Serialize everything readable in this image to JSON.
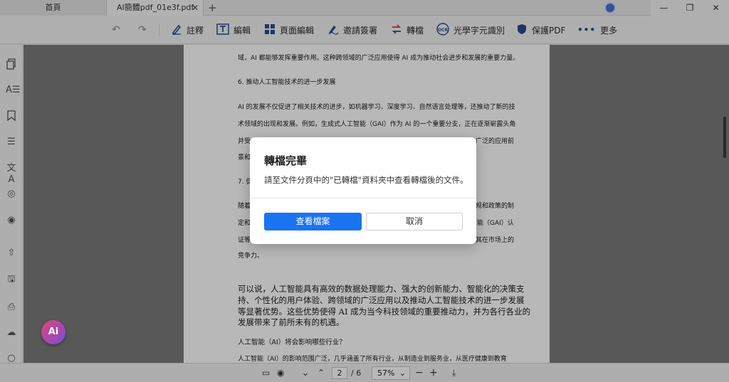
{
  "tabs": {
    "home_label": "首頁",
    "doc_label": "AI簡體pdf_01e3f.pdf",
    "close": "✕",
    "add": "+"
  },
  "window": {
    "minimize": "—",
    "restore": "❐",
    "close": "✕"
  },
  "toolbar": {
    "undo": "↶",
    "redo": "↷",
    "items": [
      {
        "label": "註釋",
        "icon": "pen-icon"
      },
      {
        "label": "編輯",
        "icon": "text-edit-icon"
      },
      {
        "label": "頁面編輯",
        "icon": "grid-icon"
      },
      {
        "label": "邀請簽署",
        "icon": "signature-icon"
      },
      {
        "label": "轉檔",
        "icon": "convert-icon"
      },
      {
        "label": "光學字元識別",
        "icon": "ocr-icon"
      },
      {
        "label": "保護PDF",
        "icon": "shield-icon"
      },
      {
        "label": "更多",
        "icon": "more-icon"
      }
    ]
  },
  "document": {
    "lines_small": [
      "域，AI 都能够发挥重要作用。这种跨领域的广泛应用使得 AI 成为推动社会进步和发展的重要力量。",
      "6. 推动人工智能技术的进一步发展",
      "AI 的发展不仅促进了相关技术的进步，如机器学习、深度学习、自然语言处理等，还推动了新的技",
      "术领域的出现和发展。例如，生成式人工智能（GAI）作为 AI 的一个重要分支，正在逐渐崭露头角",
      "并受",
      "景和",
      "7. 促",
      "随着",
      "定和",
      "证等",
      "竞争力。"
    ],
    "lines_small_right": [
      "广泛的应用前",
      "规和政策的制",
      "智能（GAI）认",
      "其在市场上的"
    ],
    "lines_large": [
      "可以说，人工智能具有高效的数据处理能力、强大的创新能力、智能化的决策支",
      "持、个性化的用户体验、跨领域的广泛应用以及推动人工智能技术的进一步发展",
      "等显著优势。这些优势使得 AI 成为当今科技领域的重要推动力，并为各行各业的",
      "发展带来了前所未有的机遇。"
    ],
    "heading2": "人工智能（AI）将会影响哪些行业？",
    "last_line": "人工智能（AI）的影响范围广泛，几乎涵盖了所有行业，从制造业到服务业，从医疗健康到教育"
  },
  "ai_button": "Ai",
  "bottom": {
    "current_page": "2",
    "page_total": "/ 6",
    "zoom": "57%"
  },
  "modal": {
    "title": "轉檔完畢",
    "message": "請至文件分頁中的\"已轉檔\"資料夾中查看轉檔後的文件。",
    "primary_label": "查看檔案",
    "secondary_label": "取消"
  },
  "colors": {
    "primary_button": "#1a73f0",
    "ai_gradient_start": "#e0447c",
    "ai_gradient_end": "#7b4bd6"
  }
}
